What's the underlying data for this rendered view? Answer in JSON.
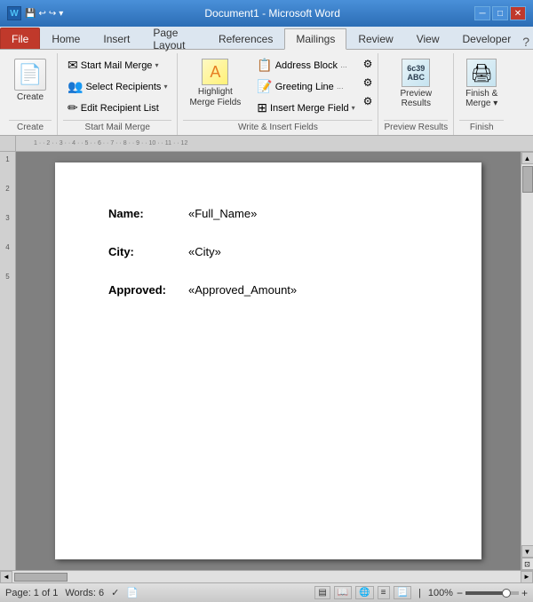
{
  "titlebar": {
    "title": "Document1 - Microsoft Word",
    "quick_access": [
      "undo",
      "redo",
      "save"
    ],
    "min": "🗕",
    "max": "🗗",
    "close": "✕"
  },
  "tabs": {
    "items": [
      "File",
      "Home",
      "Insert",
      "Page Layout",
      "References",
      "Mailings",
      "Review",
      "View",
      "Developer"
    ],
    "active": "Mailings"
  },
  "ribbon": {
    "groups": [
      {
        "label": "Create",
        "buttons": [
          {
            "id": "create",
            "label": "Create",
            "large": true
          }
        ]
      },
      {
        "label": "Start Mail Merge",
        "buttons": [
          {
            "id": "start-mail-merge",
            "label": "Start Mail Merge",
            "arrow": true
          },
          {
            "id": "select-recipients",
            "label": "Select Recipients",
            "arrow": true
          },
          {
            "id": "edit-recipient-list",
            "label": "Edit Recipient List"
          }
        ]
      },
      {
        "label": "Write & Insert Fields",
        "buttons": [
          {
            "id": "highlight-merge-fields",
            "label": "Highlight\nMerge Fields",
            "large": true
          },
          {
            "id": "address-block",
            "label": "Address Block…"
          },
          {
            "id": "greeting-line",
            "label": "Greeting Line…"
          },
          {
            "id": "insert-merge-field",
            "label": "Insert Merge Field",
            "arrow": true
          }
        ]
      },
      {
        "label": "Preview Results",
        "buttons": [
          {
            "id": "preview-results",
            "label": "Preview\nResults",
            "large": true
          }
        ]
      },
      {
        "label": "Finish",
        "buttons": [
          {
            "id": "finish-merge",
            "label": "Finish &\nMerge",
            "large": true,
            "arrow": true
          }
        ]
      }
    ]
  },
  "document": {
    "fields": [
      {
        "label": "Name:",
        "value": "«Full_Name»"
      },
      {
        "label": "City:",
        "value": "«City»"
      },
      {
        "label": "Approved:",
        "value": "«Approved_Amount»"
      }
    ]
  },
  "statusbar": {
    "page": "Page: 1 of 1",
    "words": "Words: 6",
    "zoom": "100%"
  },
  "icons": {
    "create": "📄",
    "mail-merge": "✉",
    "recipients": "👥",
    "edit": "✏",
    "highlight": "🖊",
    "address": "📋",
    "greeting": "📝",
    "insert": "⊞",
    "preview": "🔍",
    "finish": "🖨",
    "spell": "✓",
    "track": "📌"
  }
}
